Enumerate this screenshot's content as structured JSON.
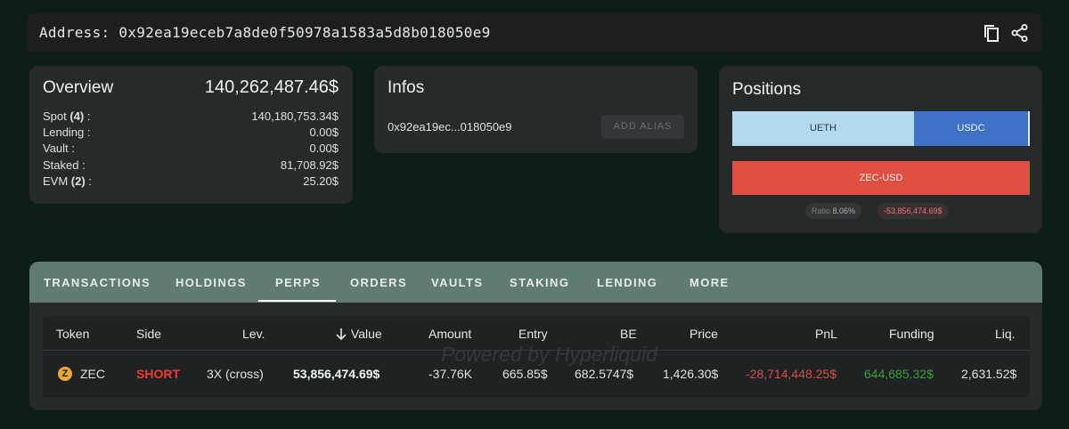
{
  "address_bar": {
    "label": "Address:",
    "address": "0x92ea19eceb7a8de0f50978a1583a5d8b018050e9",
    "copy_icon": "copy-icon",
    "share_icon": "share-icon"
  },
  "overview": {
    "title": "Overview",
    "total": "140,262,487.46$",
    "rows": [
      {
        "label": "Spot",
        "count": "(4)",
        "suffix": " :",
        "value": "140,180,753.34$"
      },
      {
        "label": "Lending :",
        "value": "0.00$"
      },
      {
        "label": "Vault :",
        "value": "0.00$"
      },
      {
        "label": "Staked :",
        "value": "81,708.92$"
      },
      {
        "label": "EVM",
        "count": "(2)",
        "suffix": " :",
        "value": "25.20$"
      }
    ]
  },
  "infos": {
    "title": "Infos",
    "short_address": "0x92ea19ec...018050e9",
    "add_alias_label": "ADD ALIAS"
  },
  "positions": {
    "title": "Positions",
    "bar1": [
      {
        "label": "UETH",
        "color": "#b3d9ec"
      },
      {
        "label": "USDC",
        "color": "#3f72c6"
      }
    ],
    "bar2": {
      "label": "ZEC-USD",
      "color": "#df4e40"
    },
    "ratio_label": "Ratio",
    "ratio_value": "8.06%",
    "pnl": "-53,856,474.69$"
  },
  "tabs": [
    "TRANSACTIONS",
    "HOLDINGS",
    "PERPS",
    "ORDERS",
    "VAULTS",
    "STAKING",
    "LENDING",
    "MORE"
  ],
  "active_tab": "PERPS",
  "table": {
    "watermark": "Powered by Hyperliquid",
    "sort_icon": "arrow-down-icon",
    "columns": [
      "Token",
      "Side",
      "Lev.",
      "Value",
      "Amount",
      "Entry",
      "BE",
      "Price",
      "PnL",
      "Funding",
      "Liq."
    ],
    "row": {
      "token_icon": "zec-coin-icon",
      "token": "ZEC",
      "side": "SHORT",
      "lev": "3X (cross)",
      "value": "53,856,474.69$",
      "amount": "-37.76K",
      "entry": "665.85$",
      "be": "682.5747$",
      "price": "1,426.30$",
      "pnl": "-28,714,448.25$",
      "funding": "644,685.32$",
      "liq": "2,631.52$"
    }
  },
  "colors": {
    "background": "#0f1d19",
    "card": "#262a2a",
    "tab_bar": "#5f7b74",
    "short": "#ef3b30",
    "negative": "#e04a44",
    "positive": "#3e9d38"
  }
}
